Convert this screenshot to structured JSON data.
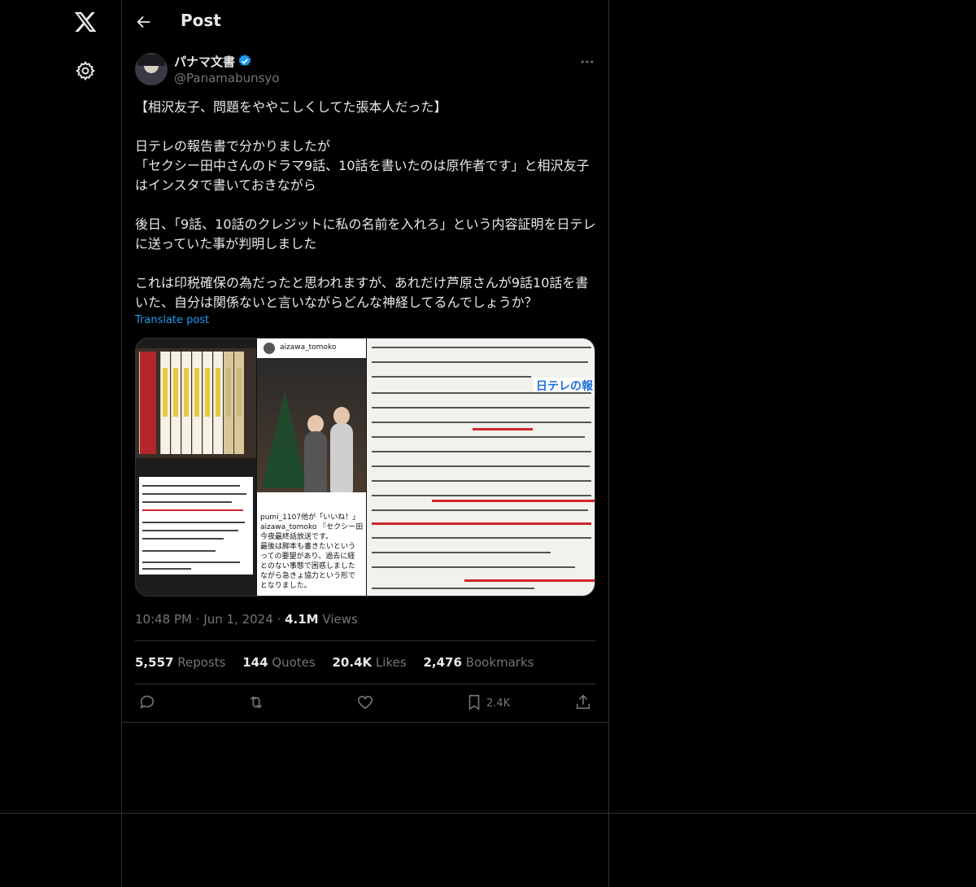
{
  "header": {
    "title": "Post"
  },
  "author": {
    "name": "パナマ文書",
    "handle": "@Panamabunsyo"
  },
  "post": {
    "text": "【相沢友子、問題をややこしくしてた張本人だった】\n\n日テレの報告書で分かりましたが\n「セクシー田中さんのドラマ9話、10話を書いたのは原作者です」と相沢友子はインスタで書いておきながら\n\n後日、「9話、10話のクレジットに私の名前を入れろ」という内容証明を日テレに送っていた事が判明しました\n\nこれは印税確保の為だったと思われますが、あれだけ芦原さんが9話10話を書いた、自分は関係ないと言いながらどんな神経してるんでしょうか？",
    "translate_label": "Translate post"
  },
  "media": {
    "instagram_user": "aizawa_tomoko",
    "instagram_caption": "pumi_1107他が「いいね！」\naizawa_tomoko 『セクシー田\n今夜最終話放送です。\n最後は脚本も書きたいという\nっての要望があり、過去に経\nとのない事態で困惑しました\nながら急きょ協力という形で\nとなりました。",
    "doc_title": "日テレの報"
  },
  "meta": {
    "time": "10:48 PM",
    "date": "Jun 1, 2024",
    "views_count": "4.1M",
    "views_label": "Views"
  },
  "stats": {
    "reposts_count": "5,557",
    "reposts_label": "Reposts",
    "quotes_count": "144",
    "quotes_label": "Quotes",
    "likes_count": "20.4K",
    "likes_label": "Likes",
    "bookmarks_count": "2,476",
    "bookmarks_label": "Bookmarks"
  },
  "actions": {
    "bookmark_count": "2.4K"
  },
  "icons": [
    "x-logo-icon",
    "gear-icon",
    "back-arrow-icon",
    "verified-badge-icon",
    "more-icon",
    "reply-icon",
    "repost-icon",
    "like-icon",
    "bookmark-icon",
    "share-icon"
  ],
  "colors": {
    "background": "#000000",
    "text": "#e7e9ea",
    "muted": "#71767b",
    "accent": "#1d9bf0",
    "border": "#2f3336"
  }
}
